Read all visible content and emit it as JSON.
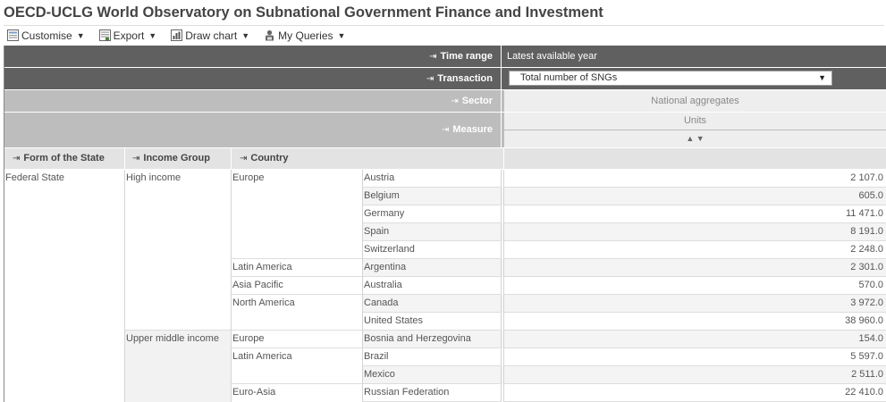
{
  "title": "OECD-UCLG World Observatory on Subnational Government Finance and Investment",
  "toolbar": {
    "customise": "Customise",
    "export": "Export",
    "draw_chart": "Draw chart",
    "my_queries": "My Queries"
  },
  "header": {
    "time_range_label": "Time range",
    "time_range_value": "Latest available year",
    "transaction_label": "Transaction",
    "transaction_value": "Total number of SNGs",
    "sector_label": "Sector",
    "sector_value": "National aggregates",
    "measure_label": "Measure",
    "measure_value": "Units"
  },
  "columns": {
    "form": "Form of the State",
    "income": "Income Group",
    "country": "Country"
  },
  "groups": {
    "form_federal": "Federal State",
    "income_high": "High income",
    "income_upper": "Upper middle income",
    "region_europe_1": "Europe",
    "region_latam_1": "Latin America",
    "region_asia_pacific": "Asia Pacific",
    "region_north_america": "North America",
    "region_europe_2": "Europe",
    "region_latam_2": "Latin America",
    "region_euro_asia": "Euro-Asia"
  },
  "rows": [
    {
      "country": "Austria",
      "value": "2 107.0"
    },
    {
      "country": "Belgium",
      "value": "605.0"
    },
    {
      "country": "Germany",
      "value": "11 471.0"
    },
    {
      "country": "Spain",
      "value": "8 191.0"
    },
    {
      "country": "Switzerland",
      "value": "2 248.0"
    },
    {
      "country": "Argentina",
      "value": "2 301.0"
    },
    {
      "country": "Australia",
      "value": "570.0"
    },
    {
      "country": "Canada",
      "value": "3 972.0"
    },
    {
      "country": "United States",
      "value": "38 960.0"
    },
    {
      "country": "Bosnia and Herzegovina",
      "value": "154.0"
    },
    {
      "country": "Brazil",
      "value": "5 597.0"
    },
    {
      "country": "Mexico",
      "value": "2 511.0"
    },
    {
      "country": "Russian Federation",
      "value": "22 410.0"
    }
  ]
}
